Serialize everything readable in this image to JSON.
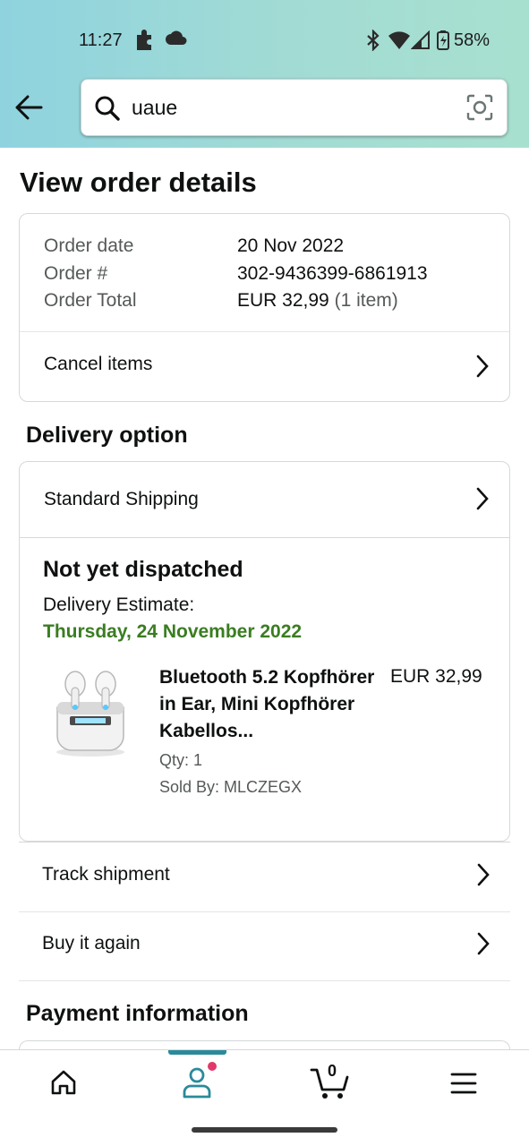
{
  "status_bar": {
    "time": "11:27",
    "battery": "58%"
  },
  "search": {
    "value": "uaue"
  },
  "page_title": "View order details",
  "order": {
    "date_label": "Order date",
    "date_value": "20 Nov 2022",
    "number_label": "Order #",
    "number_value": "302-9436399-6861913",
    "total_label": "Order Total",
    "total_value": "EUR 32,99",
    "total_items": "(1 item)",
    "cancel_label": "Cancel items"
  },
  "delivery": {
    "section_title": "Delivery option",
    "shipping_method": "Standard Shipping",
    "status": "Not yet dispatched",
    "estimate_label": "Delivery Estimate:",
    "estimate_date": "Thursday, 24 November 2022",
    "estimate_color": "#3a7d21"
  },
  "product": {
    "title": "Bluetooth 5.2 Kopfhörer in Ear, Mini Kopfhörer Kabellos...",
    "price": "EUR 32,99",
    "qty": "Qty: 1",
    "seller": "Sold By: MLCZEGX"
  },
  "actions": {
    "track": "Track shipment",
    "buy_again": "Buy it again"
  },
  "payment": {
    "section_title": "Payment information"
  },
  "bottom_nav": {
    "items": [
      "home-icon",
      "account-icon",
      "cart-icon",
      "menu-icon"
    ],
    "cart_count": "0",
    "accent_color": "#2a8a9a",
    "notification_color": "#e3386b"
  }
}
